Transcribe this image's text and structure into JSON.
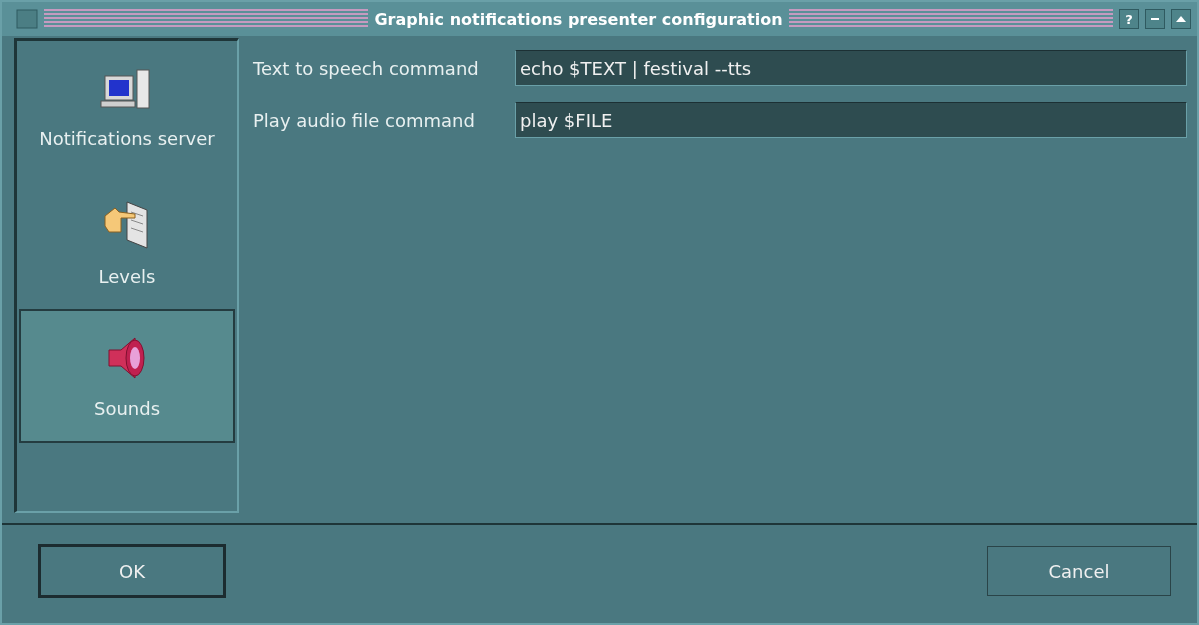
{
  "window": {
    "title": "Graphic notifications presenter configuration",
    "help_button": "?"
  },
  "sidebar": {
    "items": [
      {
        "label": "Notifications server",
        "kind": "computer",
        "selected": false
      },
      {
        "label": "Levels",
        "kind": "hand",
        "selected": false
      },
      {
        "label": "Sounds",
        "kind": "speaker",
        "selected": true
      }
    ]
  },
  "fields": [
    {
      "label": "Text to speech command",
      "value": "echo $TEXT | festival --tts"
    },
    {
      "label": "Play audio file command",
      "value": "play $FILE"
    }
  ],
  "buttons": [
    {
      "label": "OK",
      "default": true
    },
    {
      "label": "Cancel",
      "default": false
    }
  ]
}
